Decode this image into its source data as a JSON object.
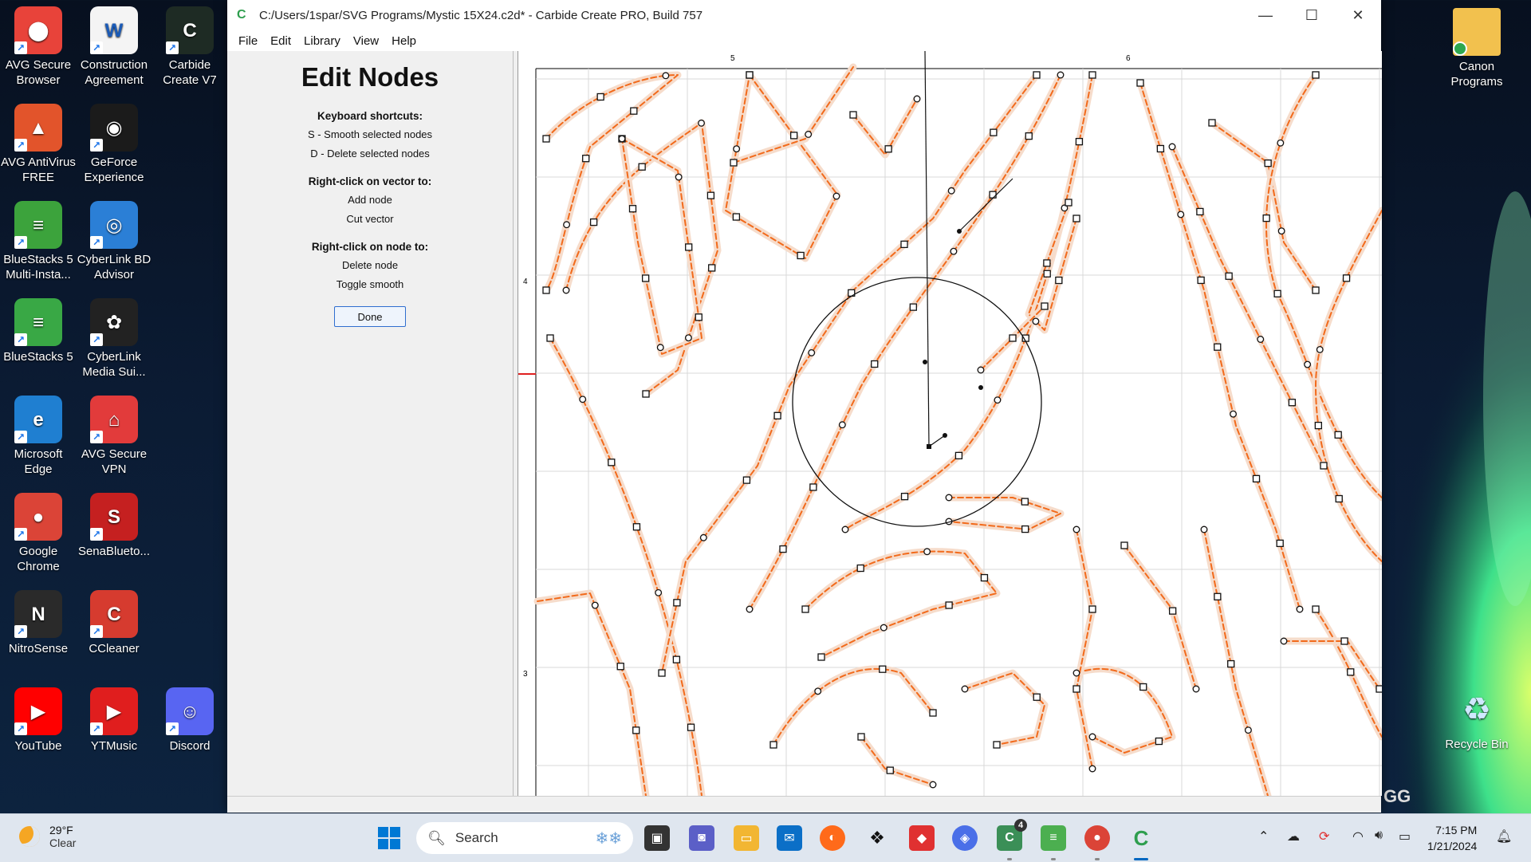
{
  "desktop": {
    "left_icons": [
      {
        "label": "AVG Secure\nBrowser",
        "color": "#e8433a",
        "glyph": "⬤"
      },
      {
        "label": "Construction\nAgreement",
        "color": "#f4f4f4",
        "glyph": "W"
      },
      {
        "label": "Carbide\nCreate V7",
        "color": "#1e2b24",
        "glyph": "C"
      },
      {
        "label": "AVG AntiVirus\nFREE",
        "color": "#e2542b",
        "glyph": "▲"
      },
      {
        "label": "GeForce\nExperience",
        "color": "#1b1b1b",
        "glyph": "◉"
      },
      {
        "label": "BlueStacks 5\nMulti-Insta...",
        "color": "#3ca33c",
        "glyph": "≡"
      },
      {
        "label": "CyberLink BD\nAdvisor",
        "color": "#2b7fd6",
        "glyph": "◎"
      },
      {
        "label": "BlueStacks 5",
        "color": "#39a845",
        "glyph": "≡"
      },
      {
        "label": "CyberLink\nMedia Sui...",
        "color": "#222",
        "glyph": "✿"
      },
      {
        "label": "Microsoft\nEdge",
        "color": "#1f7fd1",
        "glyph": "e"
      },
      {
        "label": "AVG Secure\nVPN",
        "color": "#e23b3b",
        "glyph": "⌂"
      },
      {
        "label": "Google\nChrome",
        "color": "#db4437",
        "glyph": "●"
      },
      {
        "label": "SenaBlueto...",
        "color": "#c52020",
        "glyph": "S"
      },
      {
        "label": "NitroSense",
        "color": "#2a2a2a",
        "glyph": "N"
      },
      {
        "label": "CCleaner",
        "color": "#d63b2f",
        "glyph": "C"
      },
      {
        "label": "YouTube",
        "color": "#ff0000",
        "glyph": "▶"
      },
      {
        "label": "YTMusic",
        "color": "#e01e1e",
        "glyph": "▶"
      },
      {
        "label": "Discord",
        "color": "#5865f2",
        "glyph": "☺"
      }
    ],
    "canon": {
      "label": "Canon\nPrograms"
    },
    "recycle": {
      "label": "Recycle Bin"
    },
    "watermark": "GG"
  },
  "window": {
    "title": "C:/Users/1spar/SVG Programs/Mystic 15X24.c2d* - Carbide Create PRO, Build 757",
    "menu": [
      "File",
      "Edit",
      "Library",
      "View",
      "Help"
    ],
    "controls": {
      "minimize": "—",
      "maximize": "☐",
      "close": "✕"
    }
  },
  "panel": {
    "heading": "Edit Nodes",
    "sections": [
      {
        "title": "Keyboard shortcuts:",
        "lines": [
          "S - Smooth selected nodes",
          "D - Delete selected nodes"
        ]
      },
      {
        "title": "Right-click on vector to:",
        "lines": [
          "Add node",
          "Cut vector"
        ]
      },
      {
        "title": "Right-click on node to:",
        "lines": [
          "Delete node",
          "Toggle smooth"
        ]
      }
    ],
    "done_label": "Done"
  },
  "canvas": {
    "ruler_top": [
      "5",
      "6"
    ],
    "ruler_left": [
      "4",
      "3"
    ]
  },
  "taskbar": {
    "weather": {
      "temp": "29°F",
      "cond": "Clear"
    },
    "search_placeholder": "Search",
    "badge": "4",
    "clock": {
      "time": "7:15 PM",
      "date": "1/21/2024"
    }
  }
}
